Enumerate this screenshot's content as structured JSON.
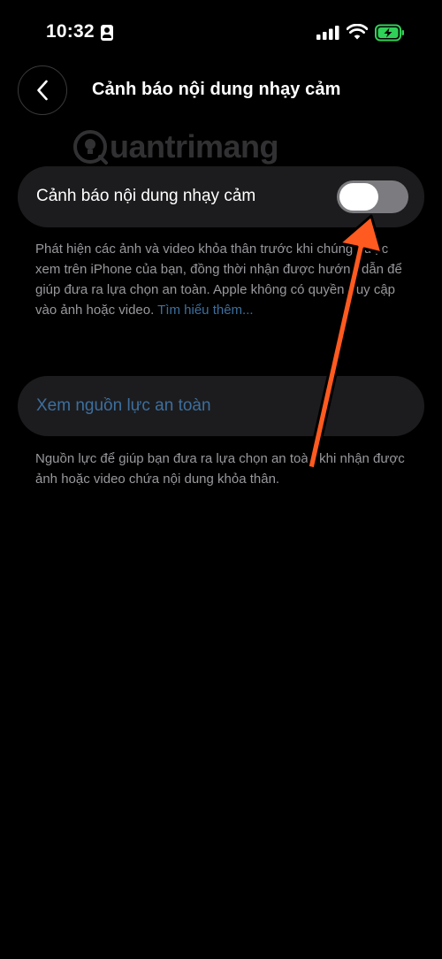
{
  "status_bar": {
    "time": "10:32"
  },
  "header": {
    "title": "Cảnh báo nội dung nhạy cảm"
  },
  "watermark": {
    "text": "uantrimang"
  },
  "toggle": {
    "label": "Cảnh báo nội dung nhạy cảm",
    "state": "off"
  },
  "description": {
    "text": "Phát hiện các ảnh và video khỏa thân trước khi chúng được xem trên iPhone của bạn, đồng thời nhận được hướng dẫn để giúp đưa ra lựa chọn an toàn. Apple không có quyền truy cập vào ảnh hoặc video. ",
    "learn_more": "Tìm hiểu thêm..."
  },
  "resources": {
    "label": "Xem nguồn lực an toàn",
    "footer": "Nguồn lực để giúp bạn đưa ra lựa chọn an toàn khi nhận được ảnh hoặc video chứa nội dung khỏa thân."
  },
  "colors": {
    "background": "#000000",
    "card": "#1c1c1e",
    "link": "#3d6f9e",
    "arrow": "#ff5a1f",
    "battery": "#30d158"
  }
}
